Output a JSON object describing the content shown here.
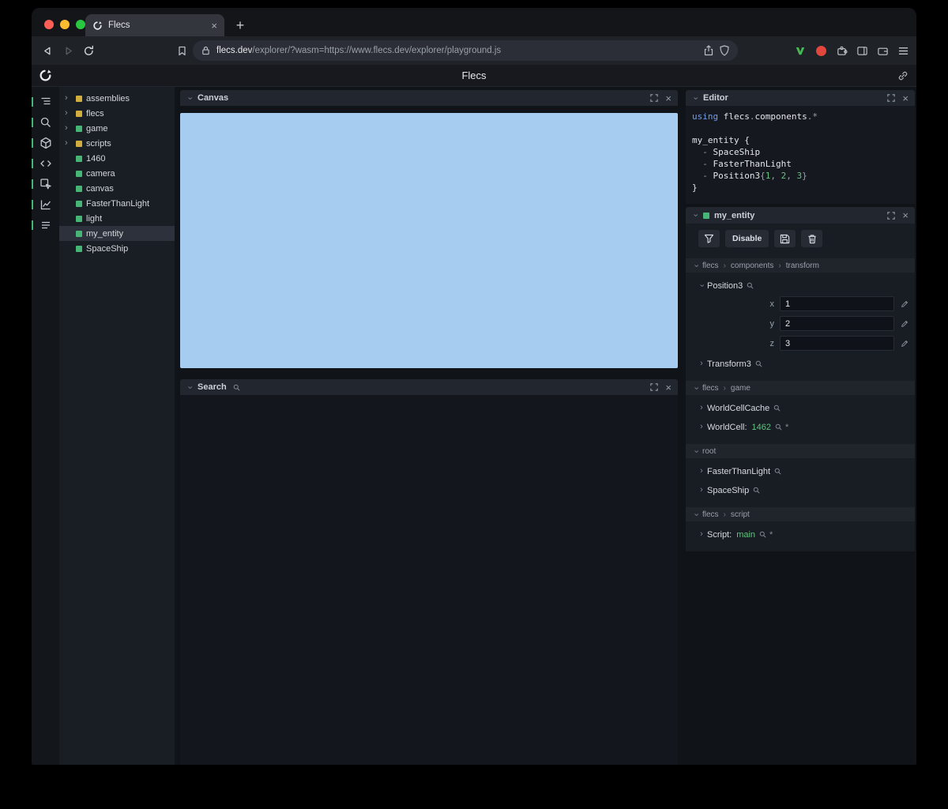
{
  "colors": {
    "accent_green": "#47b576",
    "prefab_yellow": "#d2ae3e",
    "canvas_blue": "#a6cdf0",
    "number_green": "#63c481",
    "keyword_blue": "#6f9ef0",
    "traffic_red": "#ff5f57",
    "traffic_yellow": "#febc2e",
    "traffic_green": "#28c840"
  },
  "icons": {
    "close": "×",
    "plus": "+",
    "chevron_right": "›",
    "ref_star": "*"
  },
  "browser": {
    "tab_title": "Flecs",
    "url_domain": "flecs.dev",
    "url_path": "/explorer/?wasm=https://www.flecs.dev/explorer/playground.js"
  },
  "app": {
    "title": "Flecs",
    "rail_icons": [
      "outliner-icon",
      "search-icon",
      "entities-cube-icon",
      "code-icon",
      "inspect-icon",
      "chart-icon",
      "stats-icon"
    ],
    "tree": {
      "items": [
        {
          "label": "assemblies",
          "color": "yellow",
          "expandable": true
        },
        {
          "label": "flecs",
          "color": "yellow",
          "expandable": true
        },
        {
          "label": "game",
          "color": "green",
          "expandable": true
        },
        {
          "label": "scripts",
          "color": "yellow",
          "expandable": true
        },
        {
          "label": "1460",
          "color": "green",
          "expandable": false
        },
        {
          "label": "camera",
          "color": "green",
          "expandable": false
        },
        {
          "label": "canvas",
          "color": "green",
          "expandable": false
        },
        {
          "label": "FasterThanLight",
          "color": "green",
          "expandable": false
        },
        {
          "label": "light",
          "color": "green",
          "expandable": false
        },
        {
          "label": "my_entity",
          "color": "green",
          "expandable": false,
          "selected": true
        },
        {
          "label": "SpaceShip",
          "color": "green",
          "expandable": false
        }
      ]
    },
    "panels": {
      "canvas": {
        "title": "Canvas"
      },
      "search": {
        "title": "Search"
      },
      "editor": {
        "title": "Editor"
      }
    },
    "editor_code": [
      [
        {
          "t": "using ",
          "c": "kw"
        },
        {
          "t": "flecs",
          "c": "id"
        },
        {
          "t": ".",
          "c": "pun"
        },
        {
          "t": "components",
          "c": "id"
        },
        {
          "t": ".*",
          "c": "pun"
        }
      ],
      [],
      [
        {
          "t": "my_entity {",
          "c": "id"
        }
      ],
      [
        {
          "t": "  - ",
          "c": "pun"
        },
        {
          "t": "SpaceShip",
          "c": "id"
        }
      ],
      [
        {
          "t": "  - ",
          "c": "pun"
        },
        {
          "t": "FasterThanLight",
          "c": "id"
        }
      ],
      [
        {
          "t": "  - ",
          "c": "pun"
        },
        {
          "t": "Position3",
          "c": "id"
        },
        {
          "t": "{",
          "c": "pun"
        },
        {
          "t": "1",
          "c": "num"
        },
        {
          "t": ", ",
          "c": "pun"
        },
        {
          "t": "2",
          "c": "num"
        },
        {
          "t": ", ",
          "c": "pun"
        },
        {
          "t": "3",
          "c": "num"
        },
        {
          "t": "}",
          "c": "pun"
        }
      ],
      [
        {
          "t": "}",
          "c": "id"
        }
      ]
    ],
    "inspector": {
      "title": "my_entity",
      "disable_button": "Disable",
      "sections": [
        {
          "path": [
            "flecs",
            "components",
            "transform"
          ],
          "rows": [
            {
              "name": "Position3",
              "expanded": true,
              "fields": [
                {
                  "key": "x",
                  "value": "1"
                },
                {
                  "key": "y",
                  "value": "2"
                },
                {
                  "key": "z",
                  "value": "3"
                }
              ]
            },
            {
              "name": "Transform3"
            }
          ]
        },
        {
          "path": [
            "flecs",
            "game"
          ],
          "rows": [
            {
              "name": "WorldCellCache"
            },
            {
              "name": "WorldCell",
              "value": "1462",
              "ref": true
            }
          ]
        },
        {
          "path": [
            "root"
          ],
          "rows": [
            {
              "name": "FasterThanLight"
            },
            {
              "name": "SpaceShip"
            }
          ]
        },
        {
          "path": [
            "flecs",
            "script"
          ],
          "rows": [
            {
              "name": "Script",
              "value": "main",
              "ref": true
            }
          ]
        }
      ]
    }
  }
}
